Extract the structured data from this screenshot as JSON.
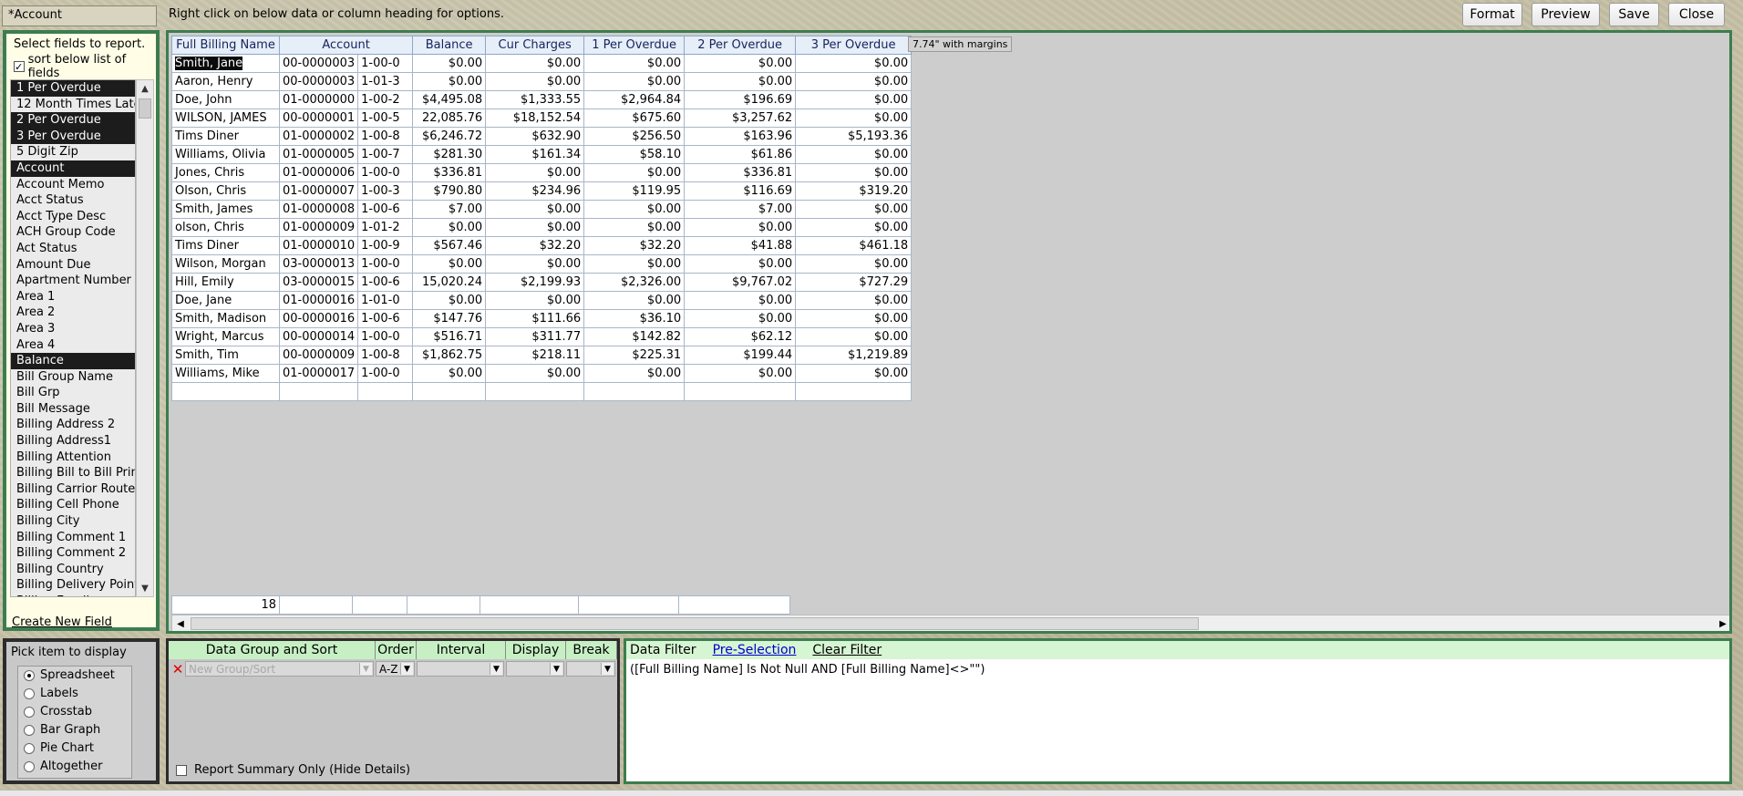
{
  "report_name": "*Account",
  "instruction": "Right click on below data or column heading for options.",
  "top_buttons": {
    "format": "Format",
    "preview": "Preview",
    "save": "Save",
    "close": "Close"
  },
  "field_panel": {
    "instruction": "Select fields to report.",
    "sort_label": "sort below list of fields",
    "create_new_field": "Create New Field",
    "items": [
      {
        "label": "1 Per Overdue",
        "selected": true
      },
      {
        "label": "12 Month Times Late",
        "selected": false
      },
      {
        "label": "2 Per Overdue",
        "selected": true
      },
      {
        "label": "3 Per Overdue",
        "selected": true
      },
      {
        "label": "5 Digit Zip",
        "selected": false
      },
      {
        "label": "Account",
        "selected": true
      },
      {
        "label": "Account Memo",
        "selected": false
      },
      {
        "label": "Acct Status",
        "selected": false
      },
      {
        "label": "Acct Type Desc",
        "selected": false
      },
      {
        "label": "ACH Group Code",
        "selected": false
      },
      {
        "label": "Act Status",
        "selected": false
      },
      {
        "label": "Amount Due",
        "selected": false
      },
      {
        "label": "Apartment Number",
        "selected": false
      },
      {
        "label": "Area 1",
        "selected": false
      },
      {
        "label": "Area 2",
        "selected": false
      },
      {
        "label": "Area 3",
        "selected": false
      },
      {
        "label": "Area 4",
        "selected": false
      },
      {
        "label": "Balance",
        "selected": true
      },
      {
        "label": "Bill Group Name",
        "selected": false
      },
      {
        "label": "Bill Grp",
        "selected": false
      },
      {
        "label": "Bill Message",
        "selected": false
      },
      {
        "label": "Billing Address 2",
        "selected": false
      },
      {
        "label": "Billing Address1",
        "selected": false
      },
      {
        "label": "Billing Attention",
        "selected": false
      },
      {
        "label": "Billing Bill to Bill Printing",
        "selected": false
      },
      {
        "label": "Billing Carrior Route",
        "selected": false
      },
      {
        "label": "Billing Cell Phone",
        "selected": false
      },
      {
        "label": "Billing City",
        "selected": false
      },
      {
        "label": "Billing Comment 1",
        "selected": false
      },
      {
        "label": "Billing Comment 2",
        "selected": false
      },
      {
        "label": "Billing Country",
        "selected": false
      },
      {
        "label": "Billing Delivery Point C",
        "selected": false
      },
      {
        "label": "Billing Email",
        "selected": false
      }
    ]
  },
  "pick_panel": {
    "title": "Pick item to display",
    "options": [
      {
        "label": "Spreadsheet",
        "checked": true
      },
      {
        "label": "Labels",
        "checked": false
      },
      {
        "label": "Crosstab",
        "checked": false
      },
      {
        "label": "Bar Graph",
        "checked": false
      },
      {
        "label": "Pie Chart",
        "checked": false
      },
      {
        "label": "Altogether",
        "checked": false
      }
    ]
  },
  "grid": {
    "width_badge": "7.74\" with margins",
    "columns": [
      "Full Billing Name",
      "Account",
      "Balance",
      "Cur Charges",
      "1 Per Overdue",
      "2 Per Overdue",
      "3 Per Overdue"
    ],
    "rows": [
      {
        "name": "Smith, Jane",
        "acct_a": "00-0000003",
        "acct_b": "1-00-0",
        "balance": "$0.00",
        "cur": "$0.00",
        "p1": "$0.00",
        "p2": "$0.00",
        "p3": "$0.00"
      },
      {
        "name": "Aaron, Henry",
        "acct_a": "00-0000003",
        "acct_b": "1-01-3",
        "balance": "$0.00",
        "cur": "$0.00",
        "p1": "$0.00",
        "p2": "$0.00",
        "p3": "$0.00"
      },
      {
        "name": "Doe, John",
        "acct_a": "01-0000000",
        "acct_b": "1-00-2",
        "balance": "$4,495.08",
        "cur": "$1,333.55",
        "p1": "$2,964.84",
        "p2": "$196.69",
        "p3": "$0.00"
      },
      {
        "name": "WILSON, JAMES",
        "acct_a": "00-0000001",
        "acct_b": "1-00-5",
        "balance": "22,085.76",
        "cur": "$18,152.54",
        "p1": "$675.60",
        "p2": "$3,257.62",
        "p3": "$0.00"
      },
      {
        "name": "Tims Diner",
        "acct_a": "01-0000002",
        "acct_b": "1-00-8",
        "balance": "$6,246.72",
        "cur": "$632.90",
        "p1": "$256.50",
        "p2": "$163.96",
        "p3": "$5,193.36"
      },
      {
        "name": "Williams, Olivia",
        "acct_a": "01-0000005",
        "acct_b": "1-00-7",
        "balance": "$281.30",
        "cur": "$161.34",
        "p1": "$58.10",
        "p2": "$61.86",
        "p3": "$0.00"
      },
      {
        "name": "Jones, Chris",
        "acct_a": "01-0000006",
        "acct_b": "1-00-0",
        "balance": "$336.81",
        "cur": "$0.00",
        "p1": "$0.00",
        "p2": "$336.81",
        "p3": "$0.00"
      },
      {
        "name": "Olson, Chris",
        "acct_a": "01-0000007",
        "acct_b": "1-00-3",
        "balance": "$790.80",
        "cur": "$234.96",
        "p1": "$119.95",
        "p2": "$116.69",
        "p3": "$319.20"
      },
      {
        "name": "Smith, James",
        "acct_a": "01-0000008",
        "acct_b": "1-00-6",
        "balance": "$7.00",
        "cur": "$0.00",
        "p1": "$0.00",
        "p2": "$7.00",
        "p3": "$0.00"
      },
      {
        "name": "olson, Chris",
        "acct_a": "01-0000009",
        "acct_b": "1-01-2",
        "balance": "$0.00",
        "cur": "$0.00",
        "p1": "$0.00",
        "p2": "$0.00",
        "p3": "$0.00"
      },
      {
        "name": "Tims Diner",
        "acct_a": "01-0000010",
        "acct_b": "1-00-9",
        "balance": "$567.46",
        "cur": "$32.20",
        "p1": "$32.20",
        "p2": "$41.88",
        "p3": "$461.18"
      },
      {
        "name": "Wilson, Morgan",
        "acct_a": "03-0000013",
        "acct_b": "1-00-0",
        "balance": "$0.00",
        "cur": "$0.00",
        "p1": "$0.00",
        "p2": "$0.00",
        "p3": "$0.00"
      },
      {
        "name": "Hill, Emily",
        "acct_a": "03-0000015",
        "acct_b": "1-00-6",
        "balance": "15,020.24",
        "cur": "$2,199.93",
        "p1": "$2,326.00",
        "p2": "$9,767.02",
        "p3": "$727.29"
      },
      {
        "name": "Doe, Jane",
        "acct_a": "01-0000016",
        "acct_b": "1-01-0",
        "balance": "$0.00",
        "cur": "$0.00",
        "p1": "$0.00",
        "p2": "$0.00",
        "p3": "$0.00"
      },
      {
        "name": "Smith, Madison",
        "acct_a": "00-0000016",
        "acct_b": "1-00-6",
        "balance": "$147.76",
        "cur": "$111.66",
        "p1": "$36.10",
        "p2": "$0.00",
        "p3": "$0.00"
      },
      {
        "name": "Wright, Marcus",
        "acct_a": "00-0000014",
        "acct_b": "1-00-0",
        "balance": "$516.71",
        "cur": "$311.77",
        "p1": "$142.82",
        "p2": "$62.12",
        "p3": "$0.00"
      },
      {
        "name": "Smith, Tim",
        "acct_a": "00-0000009",
        "acct_b": "1-00-8",
        "balance": "$1,862.75",
        "cur": "$218.11",
        "p1": "$225.31",
        "p2": "$199.44",
        "p3": "$1,219.89"
      },
      {
        "name": "Williams, Mike",
        "acct_a": "01-0000017",
        "acct_b": "1-00-0",
        "balance": "$0.00",
        "cur": "$0.00",
        "p1": "$0.00",
        "p2": "$0.00",
        "p3": "$0.00"
      }
    ],
    "total_count": "18"
  },
  "group_sort": {
    "headers": {
      "group": "Data Group and Sort",
      "order": "Order",
      "interval": "Interval",
      "display": "Display",
      "break": "Break"
    },
    "new_group_placeholder": "New Group/Sort",
    "order_value": "A-Z",
    "summary_only_label": "Report Summary Only (Hide Details)"
  },
  "data_filter": {
    "title": "Data Filter",
    "pre_selection": "Pre-Selection",
    "clear_filter": "Clear Filter",
    "expression": "([Full Billing Name] Is Not Null AND [Full Billing Name]<>\"\")"
  }
}
